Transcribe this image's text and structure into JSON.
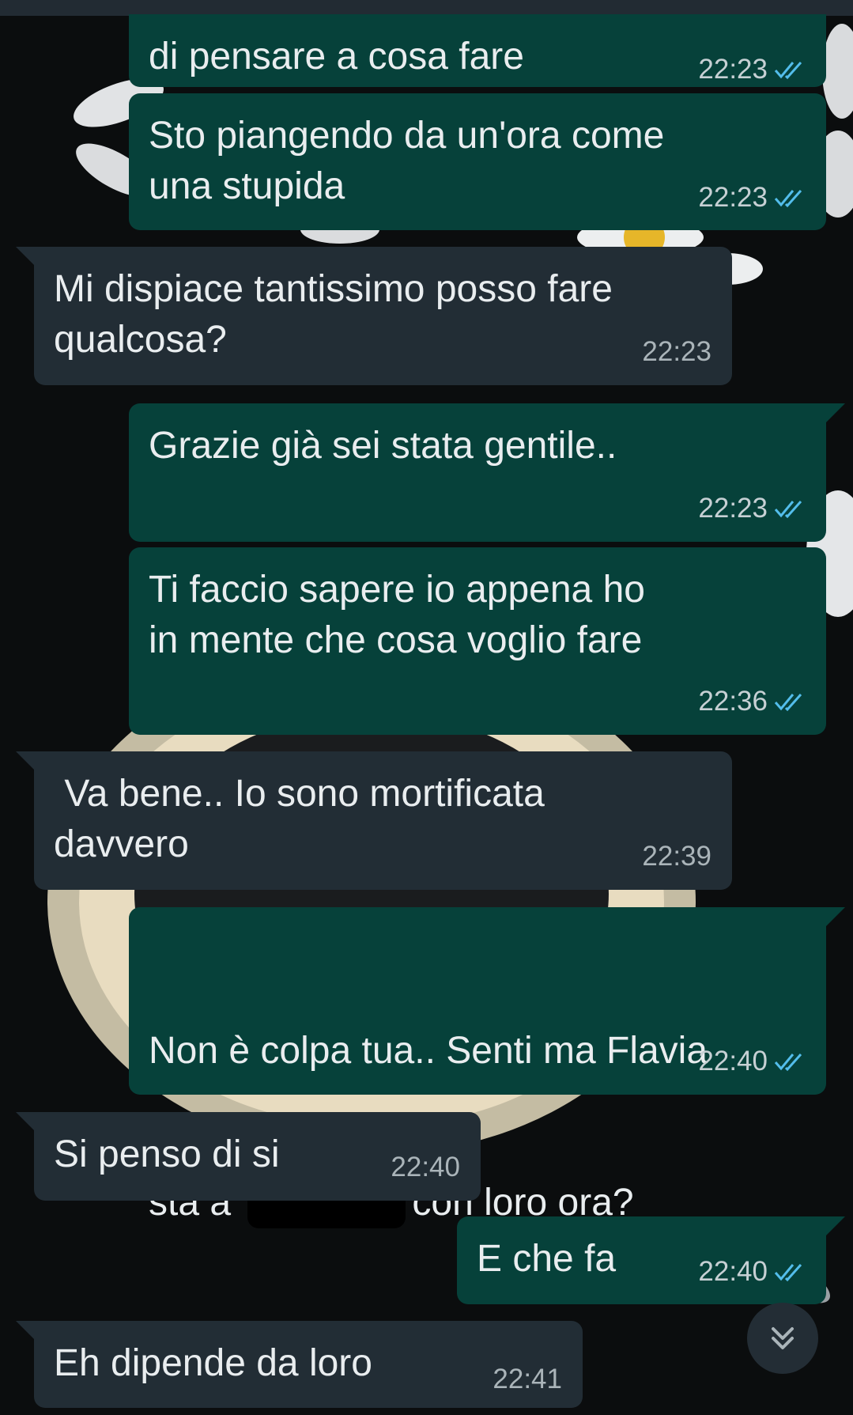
{
  "messages": [
    {
      "direction": "out",
      "text": "di pensare a cosa fare",
      "time": "22:23",
      "status": "read"
    },
    {
      "direction": "out",
      "text": "Sto piangendo da un'ora come\nuna stupida",
      "time": "22:23",
      "status": "read"
    },
    {
      "direction": "in",
      "text": "Mi dispiace tantissimo posso fare\nqualcosa?",
      "time": "22:23"
    },
    {
      "direction": "out",
      "text": "Grazie già sei stata gentile..",
      "time": "22:23",
      "status": "read"
    },
    {
      "direction": "out",
      "text": "Ti faccio sapere io appena ho\nin mente che cosa voglio fare",
      "time": "22:36",
      "status": "read"
    },
    {
      "direction": "in",
      "text": " Va bene.. Io sono mortificata\ndavvero",
      "time": "22:39"
    },
    {
      "direction": "out",
      "text_line1": "Non è colpa tua.. Senti ma Flavia",
      "text_line2_before": "sta a ",
      "text_line2_after": "con loro ora?",
      "time": "22:40",
      "status": "read"
    },
    {
      "direction": "in",
      "text": "Si penso di si",
      "time": "22:40"
    },
    {
      "direction": "out",
      "text": "E che fa",
      "time": "22:40",
      "status": "read"
    },
    {
      "direction": "in",
      "text": "Eh dipende da loro",
      "time": "22:41"
    }
  ],
  "colors": {
    "outgoing_bubble": "#06413a",
    "incoming_bubble": "#222d35",
    "read_tick": "#53bdeb",
    "text": "#e9edef"
  },
  "icons": {
    "read_receipt": "double-check-icon",
    "scroll_down": "chevron-double-down-icon"
  }
}
